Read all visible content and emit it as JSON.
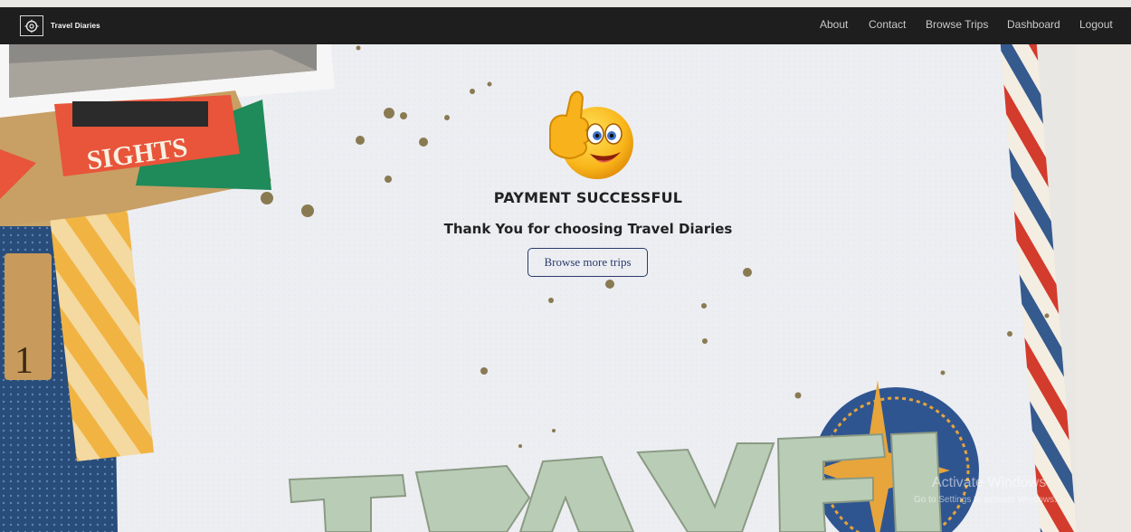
{
  "navbar": {
    "brand": "Travel Diaries",
    "links": [
      "About",
      "Contact",
      "Browse Trips",
      "Dashboard",
      "Logout"
    ]
  },
  "main": {
    "status_title": "PAYMENT SUCCESSFUL",
    "thanks_message": "Thank You for choosing Travel Diaries",
    "browse_button": "Browse more trips"
  },
  "background": {
    "sights_sticker": "SIGHTS",
    "travel_letters": "TRAVEL",
    "scrabble_tile": "1"
  },
  "watermark": {
    "title": "Activate Windows",
    "subtitle": "Go to Settings to activate Windows."
  },
  "icons": {
    "brand": "camera-shutter-icon",
    "success": "thumbs-up-emoji-icon"
  },
  "colors": {
    "navbar_bg": "#1e1e1e",
    "button_border": "#2b3a6b",
    "text_dark": "#222222"
  }
}
